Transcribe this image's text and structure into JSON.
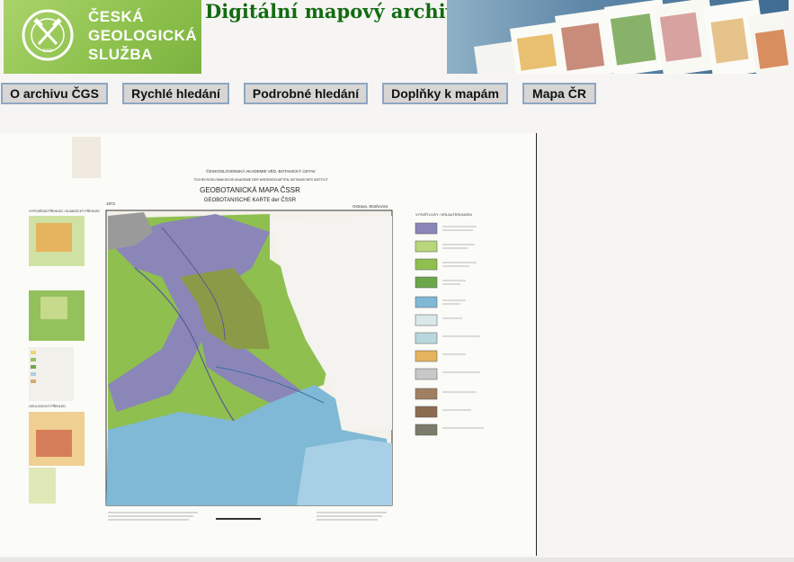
{
  "logo": {
    "lines": [
      "ČESKÁ",
      "GEOLOGICKÁ",
      "SLUŽBA"
    ],
    "emblem_name": "cgs-emblem-icon",
    "emblem_text": "ČESKÁ GEOLOGICKÁ SLUŽBA",
    "emblem_year": "1919",
    "color": "#8cc04c"
  },
  "site_title": "Digitální mapový archiv",
  "nav": {
    "items": [
      {
        "label": "O archivu ČGS"
      },
      {
        "label": "Rychlé hledání"
      },
      {
        "label": "Podrobné hledání"
      },
      {
        "label": "Doplňky k mapám"
      },
      {
        "label": "Mapa ČR"
      }
    ]
  },
  "map": {
    "header_1": "ČESKOSLOVENSKÁ AKADEMIE VĚD, BOTANICKÝ ÚSTAV",
    "header_2": "TSCHECHOSLOWAKISCHE AKADEMIE DER WISSENSCHAFTEN, BOTANISCHES INSTITUT",
    "title_cz": "GEOBOTANICKÁ MAPA ČSSR",
    "title_de": "GEOBOTANISCHE KARTE der ČSSR",
    "year": "1972",
    "sheet": "Ostrava, Strahovice",
    "legend_title": "VYSVĚTLIVKY / ERLÄUTERUNGEN",
    "inset_1": "VYPOVĚDNÍ PŘEHLED / KLIMATICKÝ PŘEHLED",
    "inset_2": "GEOLOGICKÝ PŘEHLED"
  },
  "colors": {
    "title_green": "#126b12",
    "nav_border": "#8fa6c2",
    "nav_bg": "#d7d6d4",
    "map_green": "#8fbf4f",
    "map_blue": "#7fb9d6",
    "map_purple": "#8a86b8"
  }
}
